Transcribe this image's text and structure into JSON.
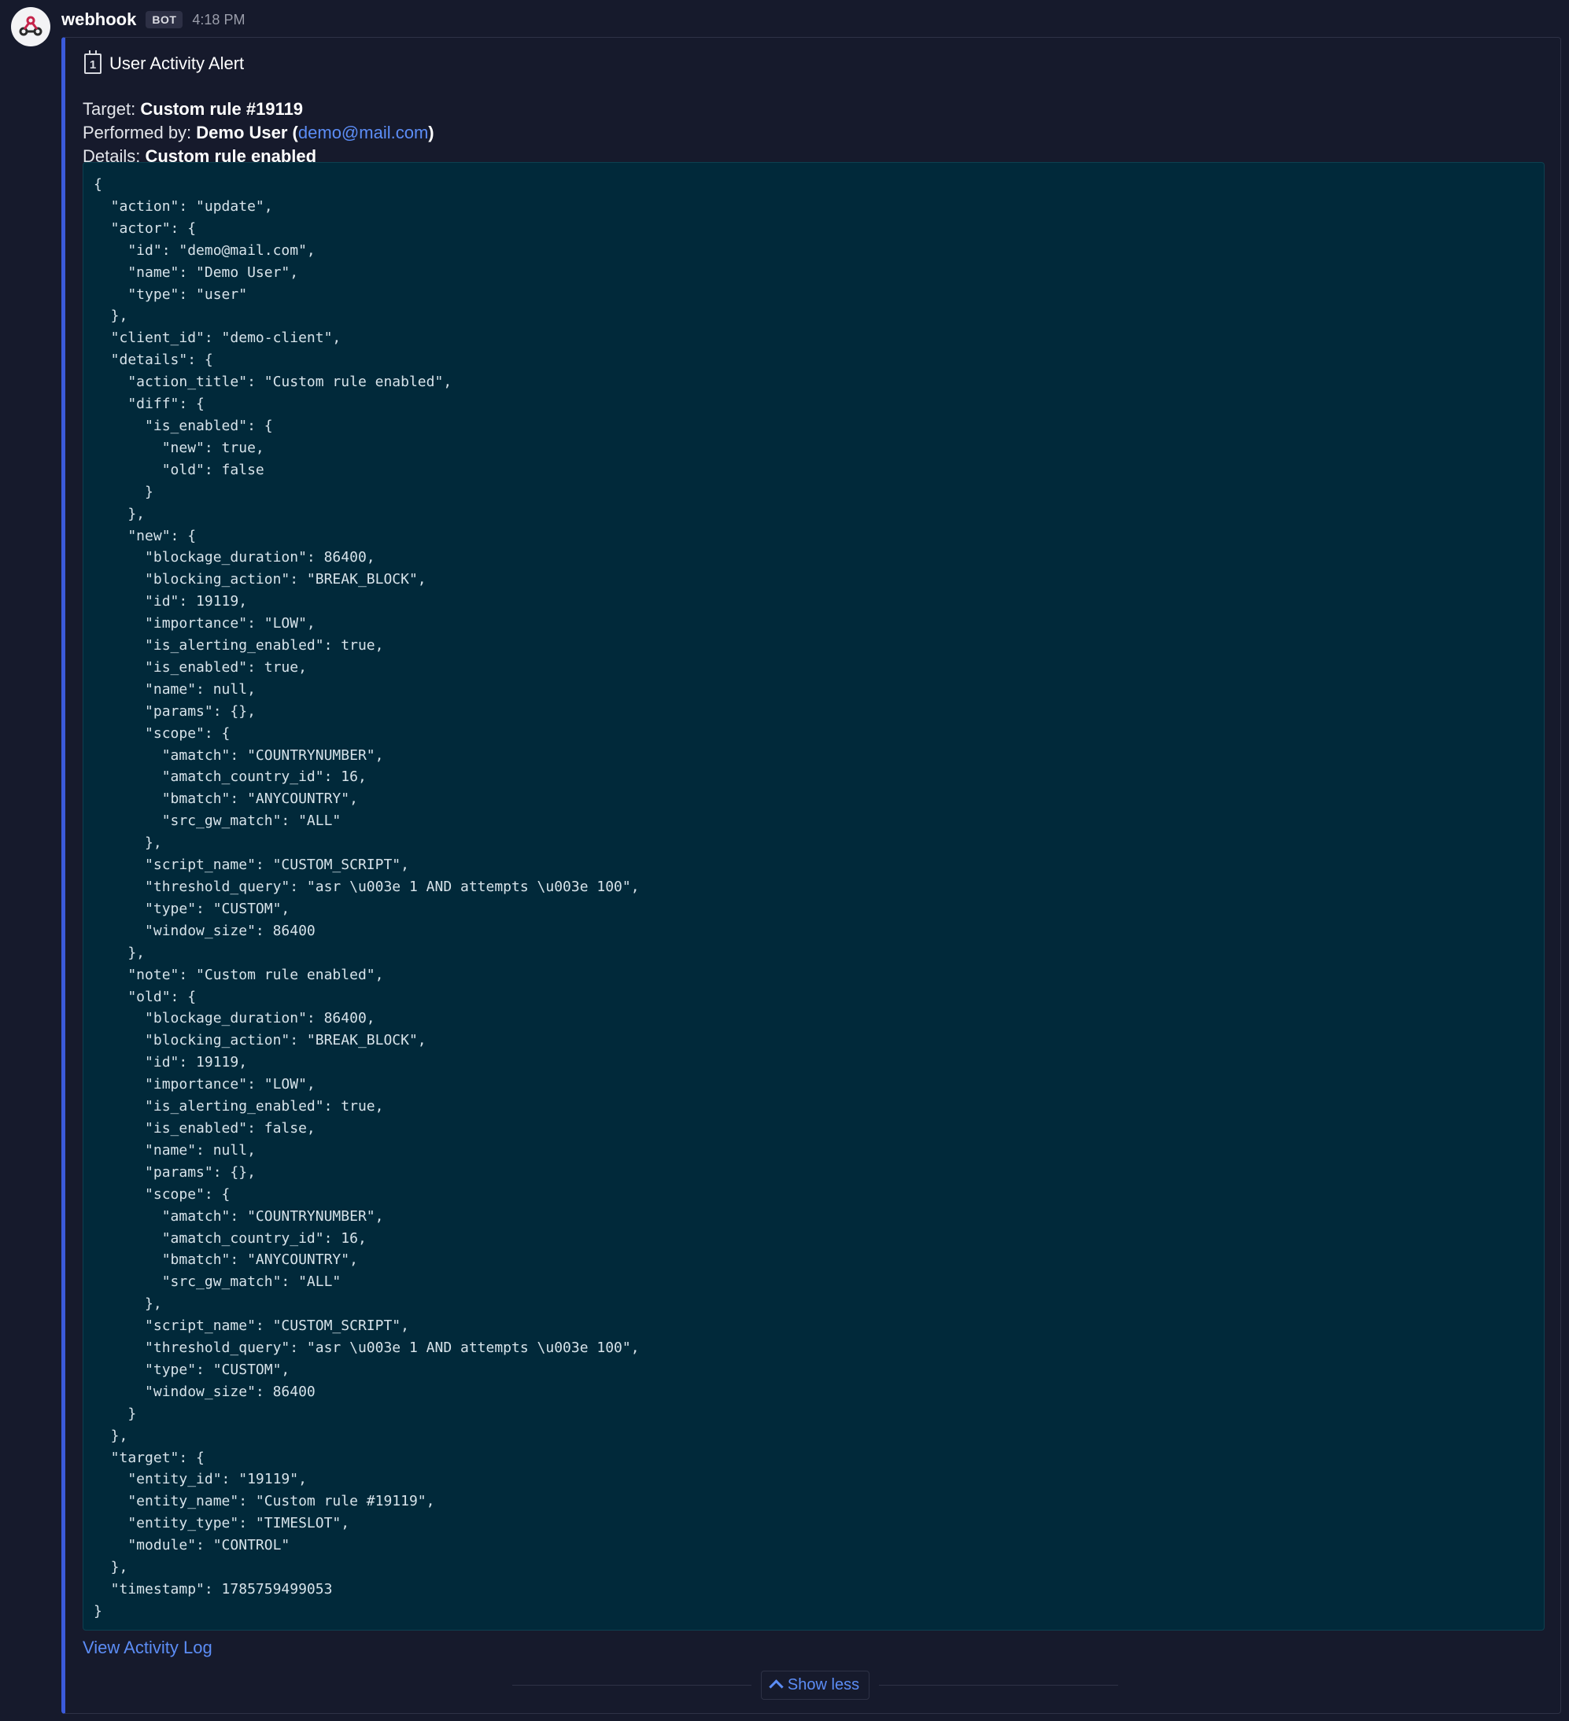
{
  "message": {
    "author": "webhook",
    "badge": "BOT",
    "time": "4:18 PM"
  },
  "attachment": {
    "title": "User Activity Alert",
    "target_label": "Target: ",
    "target_value": "Custom rule #19119",
    "performed_label": "Performed by: ",
    "performed_value": "Demo User",
    "performed_open": " (",
    "performed_email": "demo@mail.com",
    "performed_close": ")",
    "details_label": "Details: ",
    "details_value": "Custom rule enabled",
    "calendar_icon_text": "1",
    "json": "{\n  \"action\": \"update\",\n  \"actor\": {\n    \"id\": \"demo@mail.com\",\n    \"name\": \"Demo User\",\n    \"type\": \"user\"\n  },\n  \"client_id\": \"demo-client\",\n  \"details\": {\n    \"action_title\": \"Custom rule enabled\",\n    \"diff\": {\n      \"is_enabled\": {\n        \"new\": true,\n        \"old\": false\n      }\n    },\n    \"new\": {\n      \"blockage_duration\": 86400,\n      \"blocking_action\": \"BREAK_BLOCK\",\n      \"id\": 19119,\n      \"importance\": \"LOW\",\n      \"is_alerting_enabled\": true,\n      \"is_enabled\": true,\n      \"name\": null,\n      \"params\": {},\n      \"scope\": {\n        \"amatch\": \"COUNTRYNUMBER\",\n        \"amatch_country_id\": 16,\n        \"bmatch\": \"ANYCOUNTRY\",\n        \"src_gw_match\": \"ALL\"\n      },\n      \"script_name\": \"CUSTOM_SCRIPT\",\n      \"threshold_query\": \"asr \\u003e 1 AND attempts \\u003e 100\",\n      \"type\": \"CUSTOM\",\n      \"window_size\": 86400\n    },\n    \"note\": \"Custom rule enabled\",\n    \"old\": {\n      \"blockage_duration\": 86400,\n      \"blocking_action\": \"BREAK_BLOCK\",\n      \"id\": 19119,\n      \"importance\": \"LOW\",\n      \"is_alerting_enabled\": true,\n      \"is_enabled\": false,\n      \"name\": null,\n      \"params\": {},\n      \"scope\": {\n        \"amatch\": \"COUNTRYNUMBER\",\n        \"amatch_country_id\": 16,\n        \"bmatch\": \"ANYCOUNTRY\",\n        \"src_gw_match\": \"ALL\"\n      },\n      \"script_name\": \"CUSTOM_SCRIPT\",\n      \"threshold_query\": \"asr \\u003e 1 AND attempts \\u003e 100\",\n      \"type\": \"CUSTOM\",\n      \"window_size\": 86400\n    }\n  },\n  \"target\": {\n    \"entity_id\": \"19119\",\n    \"entity_name\": \"Custom rule #19119\",\n    \"entity_type\": \"TIMESLOT\",\n    \"module\": \"CONTROL\"\n  },\n  \"timestamp\": 1785759499053\n}",
    "view_log_link": "View Activity Log",
    "show_less_label": "Show less"
  },
  "colors": {
    "accent_border": "#3b5bdb",
    "link": "#5c8df6",
    "code_bg": "#01293a",
    "page_bg": "#161a2c"
  },
  "icons": {
    "avatar": "webhook-icon",
    "calendar": "calendar-icon",
    "show_less": "chevron-up-icon"
  }
}
